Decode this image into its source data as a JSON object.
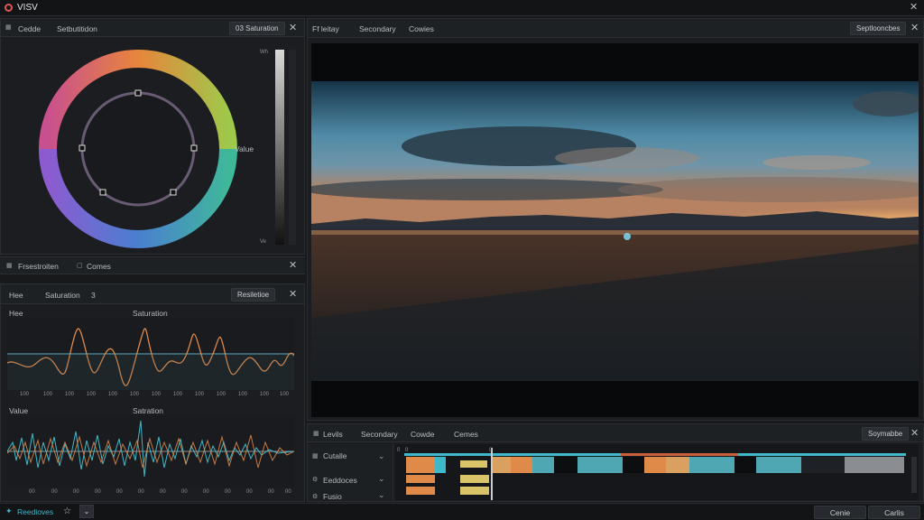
{
  "app": {
    "title": "VISV"
  },
  "color_panel": {
    "tabs": [
      "Cedde",
      "Setbutitidon"
    ],
    "saturation_pill": "03 Saturation",
    "value_label": "Value",
    "slider_top": "Wh",
    "slider_bottom": "Ve"
  },
  "mid_bar": {
    "tabs": [
      "Frsestroiten",
      "Comes"
    ]
  },
  "graph_panel": {
    "tabs": [
      "Hee",
      "Saturation",
      "3"
    ],
    "pill": "Resiletioe",
    "graph1": {
      "left_label": "Hee",
      "center_label": "Saturation",
      "ticks": [
        "100",
        "100",
        "100",
        "100",
        "100",
        "100",
        "100",
        "100",
        "100",
        "100",
        "100",
        "100",
        "100"
      ]
    },
    "graph2": {
      "left_label": "Value",
      "center_label": "Satration",
      "ticks": [
        "00",
        "00",
        "00",
        "00",
        "00",
        "00",
        "00",
        "00",
        "00",
        "00",
        "00",
        "00",
        "00"
      ]
    }
  },
  "viewer": {
    "tabs": [
      "Ff leitay",
      "Secondary",
      "Cowies"
    ],
    "pill": "Septlooncbes"
  },
  "timeline": {
    "tabs": [
      "Levils",
      "Secondary",
      "Cowde",
      "Cemes"
    ],
    "pill": "Soymabbe",
    "tracks": [
      "Cutalle",
      "Eeddoces",
      "Fusio"
    ]
  },
  "footer": {
    "left_label": "Reedioves",
    "buttons": [
      "Cenie",
      "Carlis"
    ]
  },
  "colors": {
    "accent": "#3fb8c9",
    "orange": "#e08a4a",
    "yellow": "#d9c46a",
    "red": "#e05656"
  }
}
